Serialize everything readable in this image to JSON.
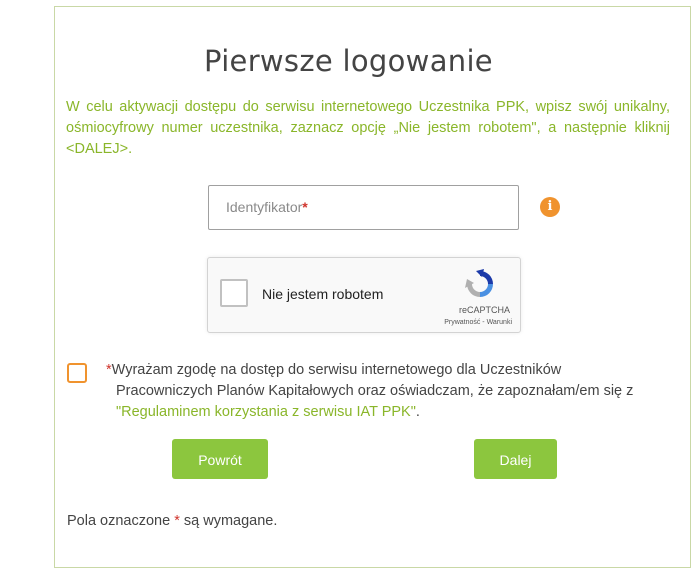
{
  "page": {
    "title": "Pierwsze logowanie",
    "intro": "W celu aktywacji dostępu do serwisu internetowego Uczestnika PPK, wpisz swój unikalny, ośmiocyfrowy numer uczestnika, zaznacz opcję „Nie jestem robotem\", a następnie kliknij <DALEJ>."
  },
  "identifier": {
    "placeholder": "Identyfikator",
    "required_mark": "*",
    "info_icon": "i"
  },
  "captcha": {
    "label": "Nie jestem robotem",
    "brand": "reCAPTCHA",
    "links": "Prywatność - Warunki",
    "icon": "recaptcha-logo"
  },
  "consent": {
    "required_mark": "*",
    "text": "Wyrażam zgodę na dostęp do serwisu internetowego dla Uczestników Pracowniczych Planów Kapitałowych oraz oświadczam, że zapoznałam/em się z ",
    "link_text": "\"Regulaminem korzystania z serwisu IAT PPK\"",
    "suffix": "."
  },
  "buttons": {
    "back": "Powrót",
    "next": "Dalej"
  },
  "footnote": {
    "before": "Pola oznaczone ",
    "mark": "*",
    "after": " są wymagane."
  },
  "colors": {
    "accent_green": "#8ab62a",
    "button_green": "#8cc63e",
    "info_orange": "#f0932e",
    "required_red": "#d0342c"
  }
}
